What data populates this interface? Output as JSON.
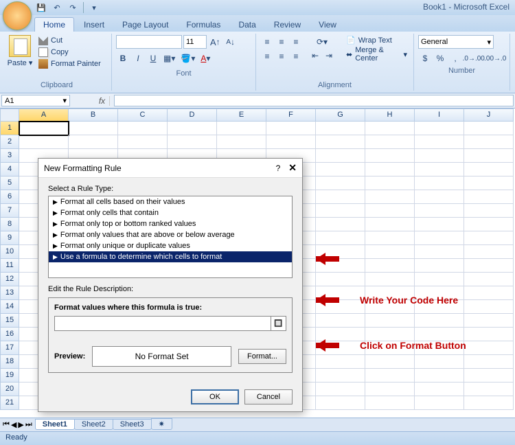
{
  "app": {
    "title": "Book1 - Microsoft Excel"
  },
  "qat": {
    "save": "💾",
    "undo": "↶",
    "redo": "↷"
  },
  "tabs": [
    "Home",
    "Insert",
    "Page Layout",
    "Formulas",
    "Data",
    "Review",
    "View"
  ],
  "ribbon": {
    "clipboard": {
      "label": "Clipboard",
      "paste": "Paste",
      "cut": "Cut",
      "copy": "Copy",
      "fp": "Format Painter"
    },
    "font": {
      "label": "Font",
      "name": "",
      "size": "11",
      "grow": "A",
      "shrink": "A",
      "bold": "B",
      "italic": "I",
      "underline": "U"
    },
    "alignment": {
      "label": "Alignment",
      "wrap": "Wrap Text",
      "merge": "Merge & Center"
    },
    "number": {
      "label": "Number",
      "format": "General",
      "currency": "$",
      "percent": "%",
      "comma": ",",
      "inc": ".0",
      "dec": ".00"
    }
  },
  "namebox": "A1",
  "columns": [
    "A",
    "B",
    "C",
    "D",
    "E",
    "F",
    "G",
    "H",
    "I",
    "J"
  ],
  "rows": [
    "1",
    "2",
    "3",
    "4",
    "5",
    "6",
    "7",
    "8",
    "9",
    "10",
    "11",
    "12",
    "13",
    "14",
    "15",
    "16",
    "17",
    "18",
    "19",
    "20",
    "21"
  ],
  "sheets": {
    "s1": "Sheet1",
    "s2": "Sheet2",
    "s3": "Sheet3"
  },
  "status": "Ready",
  "dialog": {
    "title": "New Formatting Rule",
    "help": "?",
    "select_label": "Select a Rule Type:",
    "rules": [
      "Format all cells based on their values",
      "Format only cells that contain",
      "Format only top or bottom ranked values",
      "Format only values that are above or below average",
      "Format only unique or duplicate values",
      "Use a formula to determine which cells to format"
    ],
    "edit_label": "Edit the Rule Description:",
    "formula_label": "Format values where this formula is true:",
    "preview_label": "Preview:",
    "preview_text": "No Format Set",
    "format_btn": "Format...",
    "ok": "OK",
    "cancel": "Cancel"
  },
  "annotations": {
    "a1": "",
    "a2": "Write Your Code Here",
    "a3": "Click on Format Button"
  }
}
